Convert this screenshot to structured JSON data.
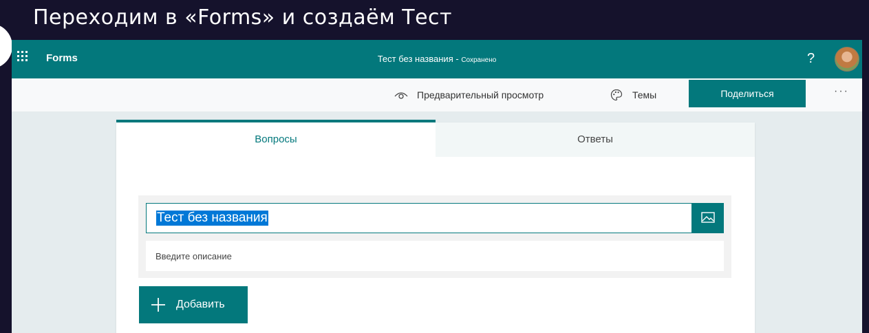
{
  "slide": {
    "title": "Переходим в «Forms» и создаём Тест"
  },
  "topbar": {
    "app_launcher_icon": "waffle-icon",
    "app_name": "Forms",
    "document_title": "Тест без названия",
    "separator": " - ",
    "save_status": "Сохранено",
    "help_label": "?",
    "avatar_icon": "user-avatar"
  },
  "commandbar": {
    "preview_icon": "eye-icon",
    "preview_label": "Предварительный просмотр",
    "themes_icon": "palette-icon",
    "themes_label": "Темы",
    "share_label": "Поделиться",
    "more_label": "···"
  },
  "tabs": [
    {
      "label": "Вопросы",
      "selected": true
    },
    {
      "label": "Ответы",
      "selected": false
    }
  ],
  "form": {
    "title_value": "Тест без названия",
    "title_selected_text": "Тест без названия",
    "image_icon": "image-icon",
    "description_placeholder": "Введите описание",
    "add_label": "Добавить",
    "add_icon": "plus-icon"
  },
  "colors": {
    "brand": "#03787c",
    "selection": "#0078d7",
    "slide_background": "#15122c"
  }
}
